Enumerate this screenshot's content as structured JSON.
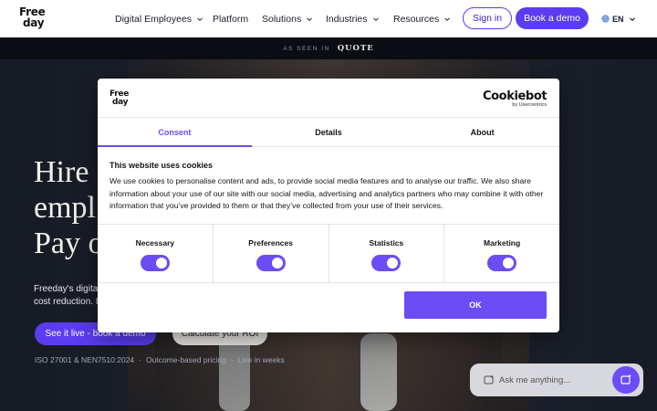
{
  "nav": {
    "logo_line1": "Free",
    "logo_line2": "day",
    "items": [
      {
        "label": "Digital Employees",
        "dropdown": true
      },
      {
        "label": "Platform",
        "dropdown": false
      },
      {
        "label": "Solutions",
        "dropdown": true
      },
      {
        "label": "Industries",
        "dropdown": true
      },
      {
        "label": "Resources",
        "dropdown": true
      }
    ],
    "signin": "Sign in",
    "book_demo": "Book a demo",
    "language": "EN"
  },
  "strip": {
    "as_seen_in": "AS SEEN IN",
    "quote": "QUOTE"
  },
  "hero": {
    "title_lines": [
      "Hire",
      "empl",
      "Pay o"
    ],
    "desc_lines": [
      "Freeday's digital",
      "cost reduction. 8"
    ],
    "cta_primary": "See it live - book a demo",
    "cta_secondary": "Calculate your ROI",
    "badges": [
      "ISO 27001 & NEN7510:2024",
      "Outcome-based pricing",
      "Live in weeks"
    ],
    "separator": "·"
  },
  "chat": {
    "placeholder": "Ask me anything..."
  },
  "cookie_dialog": {
    "logo_line1": "Free",
    "logo_line2": "day",
    "brand": "Cookiebot",
    "brand_by": "by Usercentrics",
    "tabs": [
      "Consent",
      "Details",
      "About"
    ],
    "active_tab": "Consent",
    "heading": "This website uses cookies",
    "body": "We use cookies to personalise content and ads, to provide social media features and to analyse our traffic. We also share information about your use of our site with our social media, advertising and analytics partners who may combine it with other information that you’ve provided to them or that they’ve collected from your use of their services.",
    "categories": [
      {
        "label": "Necessary",
        "enabled": true
      },
      {
        "label": "Preferences",
        "enabled": true
      },
      {
        "label": "Statistics",
        "enabled": true
      },
      {
        "label": "Marketing",
        "enabled": true
      }
    ],
    "ok": "OK"
  },
  "colors": {
    "accent": "#5b3cf0",
    "accent_light": "#6b4cf5",
    "nav_bg": "#ffffff",
    "strip_bg": "#0b0d13"
  }
}
